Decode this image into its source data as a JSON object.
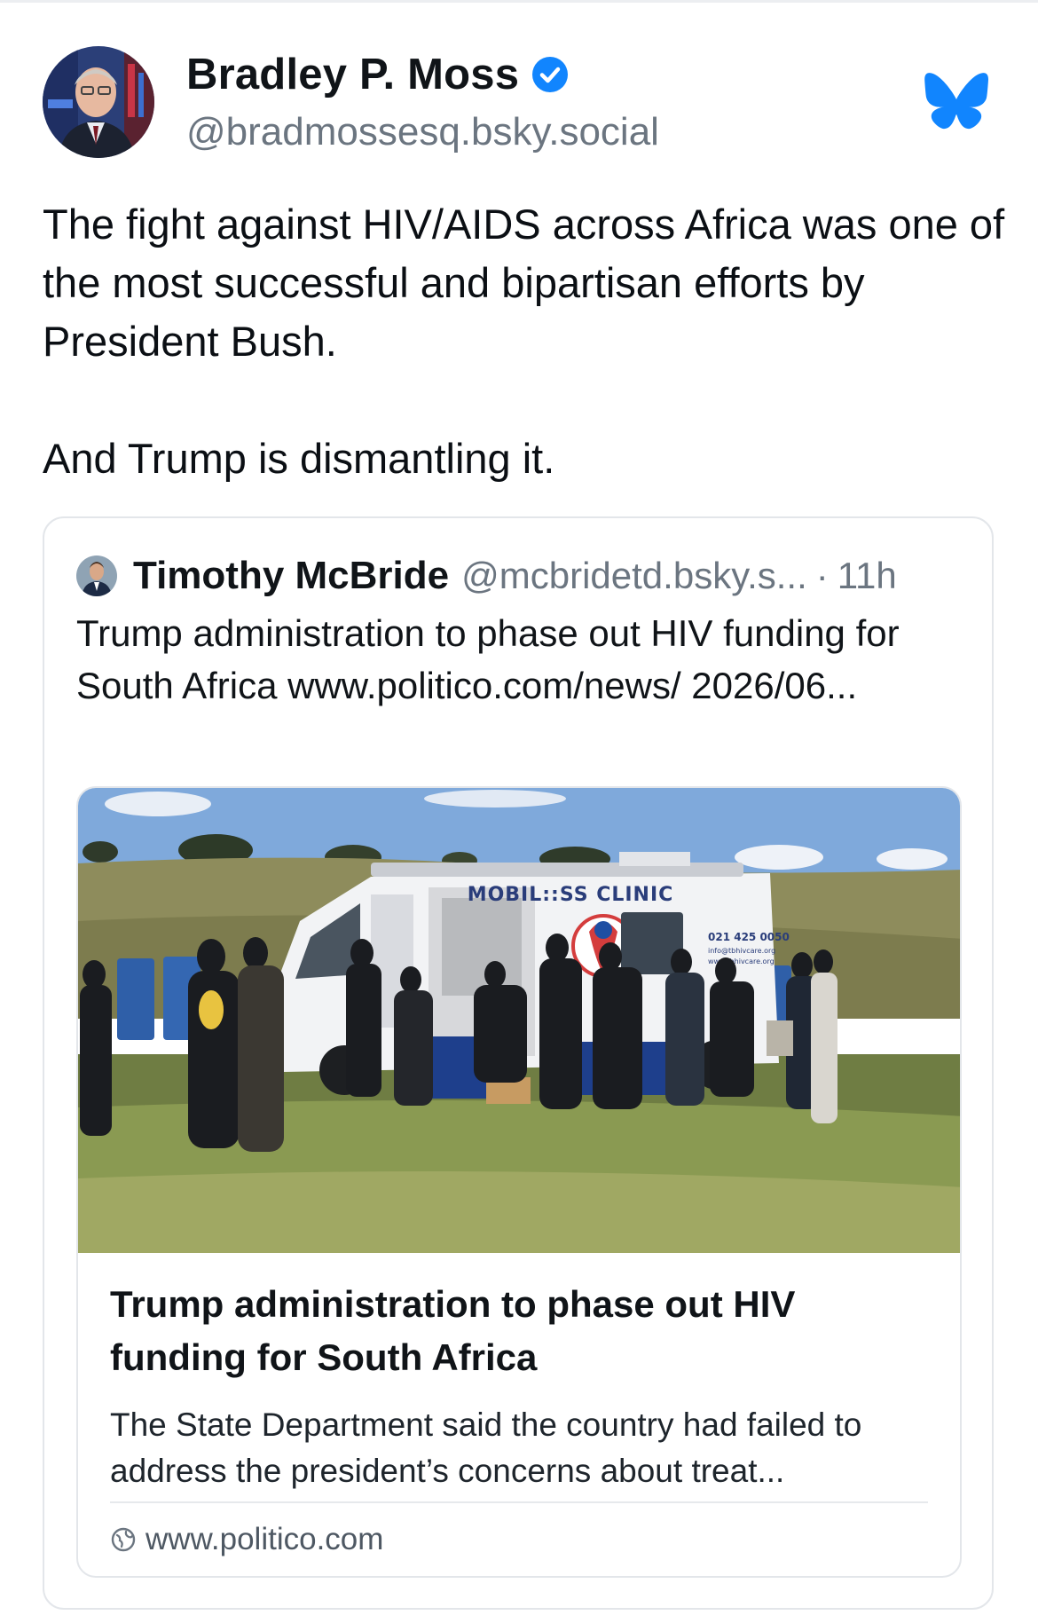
{
  "author": {
    "name": "Bradley P. Moss",
    "handle": "@bradmossesq.bsky.social",
    "verified": true,
    "avatar_icon": "profile-photo"
  },
  "app": {
    "logo_icon": "bluesky-butterfly-icon",
    "accent_color": "#1185fe"
  },
  "post": {
    "paragraphs": [
      "The fight against HIV/AIDS across Africa was one of the most successful and bipartisan efforts by President Bush.",
      "And Trump is dismantling it."
    ]
  },
  "quote": {
    "author_name": "Timothy McBride",
    "author_handle": "@mcbridetd.bsky.s...",
    "separator": "·",
    "time": "11h",
    "text": "Trump administration to phase out HIV funding for South Africa www.politico.com/news/ 2026/06...",
    "link_card": {
      "image_text": {
        "van_sign": "MOBIL::SS CLINIC",
        "van_phone": "021 425 0050",
        "van_email": "info@tbhivcare.org",
        "van_web": "www.tbhivcare.org"
      },
      "title": "Trump administration to phase out HIV funding for South Africa",
      "description": "The State Department said the country had failed to address the president’s concerns about treat...",
      "domain": "www.politico.com"
    }
  }
}
